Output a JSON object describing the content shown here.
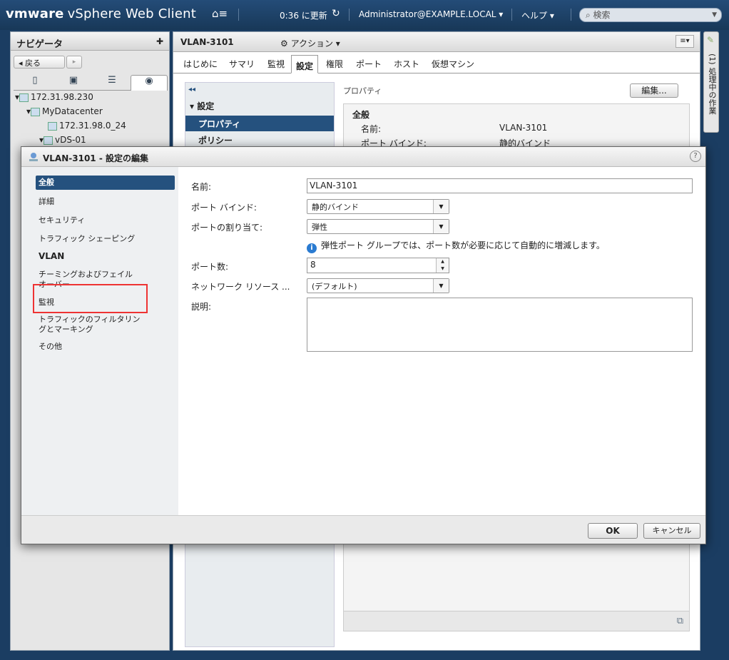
{
  "topbar": {
    "brand": "vmware",
    "product": "vSphere Web Client",
    "home_icon": "home-icon",
    "time": "0:36 に更新",
    "user": "Administrator@EXAMPLE.LOCAL",
    "help": "ヘルプ",
    "search_placeholder": "検索"
  },
  "navigator": {
    "title": "ナビゲータ",
    "back": "戻る",
    "tree": [
      {
        "label": "172.31.98.230",
        "icon": "vcenter-icon"
      },
      {
        "label": "MyDatacenter",
        "icon": "datacenter-icon"
      },
      {
        "label": "172.31.98.0_24",
        "icon": "portgroup-icon"
      },
      {
        "label": "vDS-01",
        "icon": "switch-icon"
      }
    ]
  },
  "main": {
    "object_title": "VLAN-3101",
    "actions": "アクション",
    "tabs": [
      "はじめに",
      "サマリ",
      "監視",
      "設定",
      "権限",
      "ポート",
      "ホスト",
      "仮想マシン"
    ],
    "active_tab": "設定",
    "settings_header": "設定",
    "settings_items": [
      "プロパティ",
      "ポリシー"
    ],
    "properties_label": "プロパティ",
    "edit_button": "編集...",
    "general_heading": "全般",
    "rows": [
      {
        "label": "名前:",
        "value": "VLAN-3101"
      },
      {
        "label": "ポート バインド:",
        "value": "静的バインド"
      }
    ]
  },
  "right_strip": {
    "label": "(1) 処理中の作業"
  },
  "dialog": {
    "title": "VLAN-3101 - 設定の編集",
    "nav": [
      "全般",
      "詳細",
      "セキュリティ",
      "トラフィック シェーピング",
      "VLAN",
      "チーミングおよびフェイル",
      "オーバー",
      "監視",
      "トラフィックのフィルタリン",
      "グとマーキング",
      "その他"
    ],
    "fields": {
      "name_label": "名前:",
      "name_value": "VLAN-3101",
      "port_bind_label": "ポート バインド:",
      "port_bind_value": "静的バインド",
      "port_alloc_label": "ポートの割り当て:",
      "port_alloc_value": "弾性",
      "info_text": "弾性ポート グループでは、ポート数が必要に応じて自動的に増減します。",
      "port_count_label": "ポート数:",
      "port_count_value": "8",
      "network_res_label": "ネットワーク リソース ...",
      "network_res_value": "(デフォルト)",
      "desc_label": "説明:"
    },
    "ok": "OK",
    "cancel": "キャンセル"
  }
}
